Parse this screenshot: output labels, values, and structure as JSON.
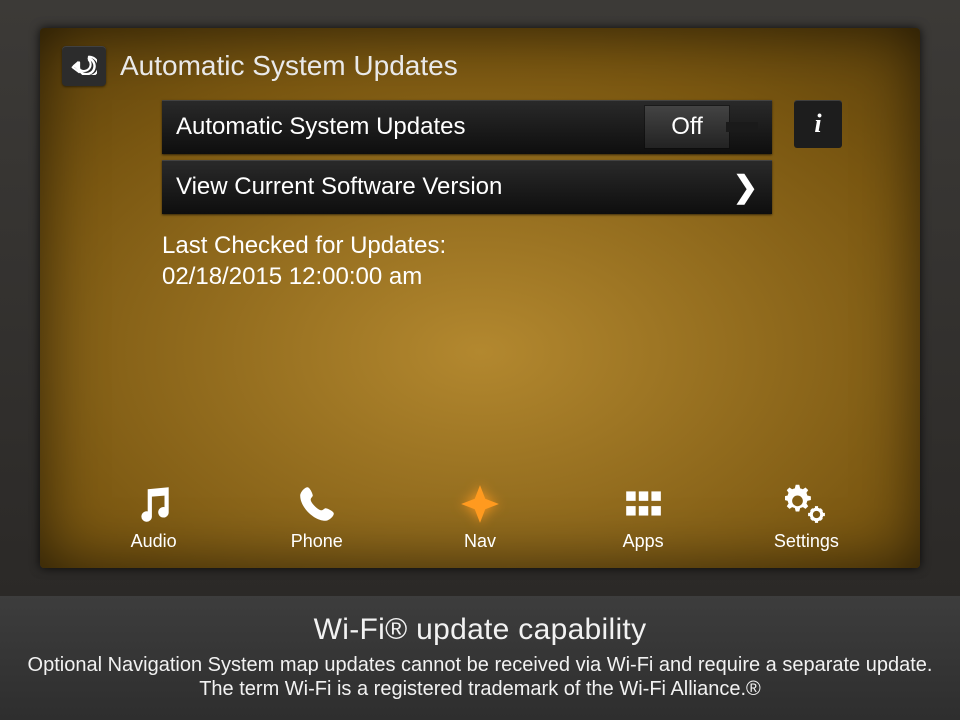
{
  "header": {
    "title": "Automatic System Updates"
  },
  "rows": {
    "auto_updates": {
      "label": "Automatic System Updates",
      "toggle": "Off",
      "info_icon": "i"
    },
    "view_version": {
      "label": "View Current Software Version",
      "chevron": "❯"
    }
  },
  "status": {
    "label": "Last Checked for Updates:",
    "value": "02/18/2015 12:00:00 am"
  },
  "nav": {
    "audio": {
      "label": "Audio"
    },
    "phone": {
      "label": "Phone"
    },
    "navi": {
      "label": "Nav"
    },
    "apps": {
      "label": "Apps"
    },
    "settings": {
      "label": "Settings"
    }
  },
  "caption": {
    "title": "Wi-Fi® update capability",
    "body": "Optional Navigation System map updates cannot be received via Wi-Fi and require a separate update. The term Wi-Fi is a registered trademark of the Wi-Fi Alliance.®"
  }
}
